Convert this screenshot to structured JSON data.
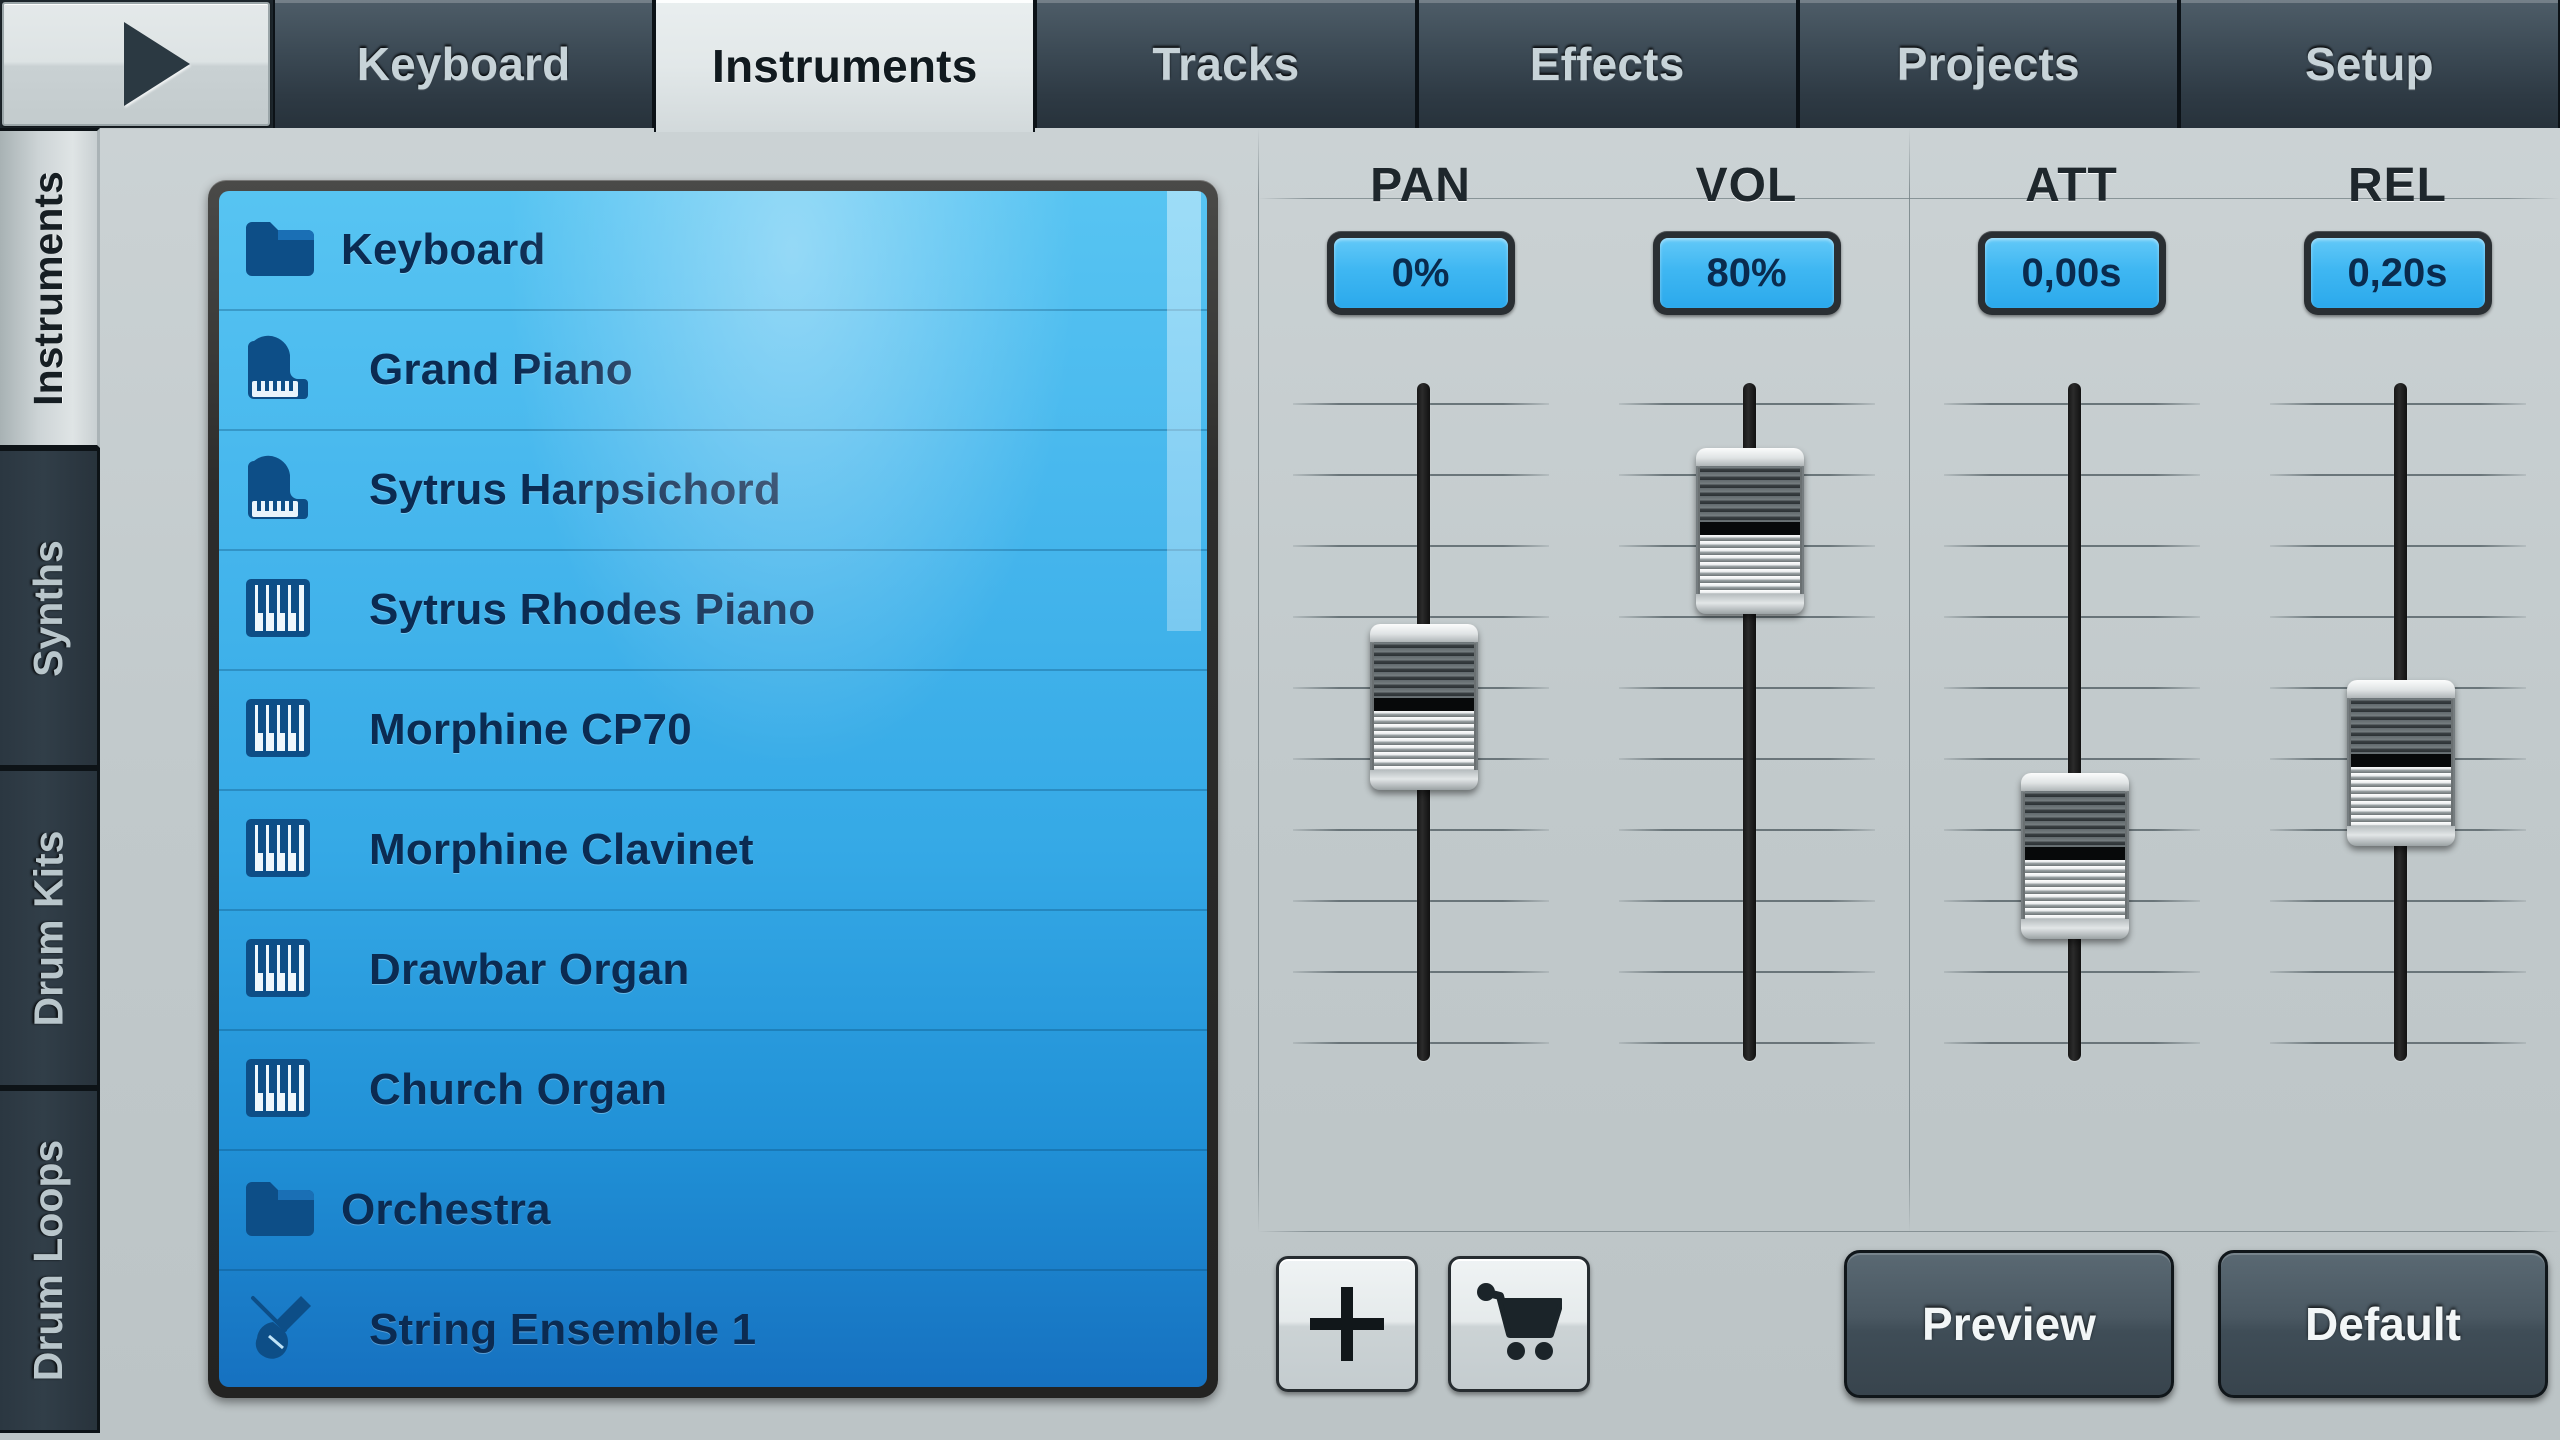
{
  "topbar": {
    "play_icon": "play-icon",
    "tabs": [
      {
        "label": "Keyboard",
        "active": false
      },
      {
        "label": "Instruments",
        "active": true
      },
      {
        "label": "Tracks",
        "active": false
      },
      {
        "label": "Effects",
        "active": false
      },
      {
        "label": "Projects",
        "active": false
      },
      {
        "label": "Setup",
        "active": false
      }
    ]
  },
  "sidebar": {
    "items": [
      {
        "label": "Instruments",
        "active": true
      },
      {
        "label": "Synths",
        "active": false
      },
      {
        "label": "Drum Kits",
        "active": false
      },
      {
        "label": "Drum Loops",
        "active": false
      }
    ]
  },
  "instrument_list": {
    "rows": [
      {
        "label": "Keyboard",
        "icon": "folder-icon",
        "type": "folder"
      },
      {
        "label": "Grand Piano",
        "icon": "grand-piano-icon",
        "type": "child"
      },
      {
        "label": "Sytrus Harpsichord",
        "icon": "grand-piano-icon",
        "type": "child"
      },
      {
        "label": "Sytrus Rhodes Piano",
        "icon": "keys-icon",
        "type": "child"
      },
      {
        "label": "Morphine CP70",
        "icon": "keys-icon",
        "type": "child"
      },
      {
        "label": "Morphine Clavinet",
        "icon": "keys-icon",
        "type": "child"
      },
      {
        "label": "Drawbar Organ",
        "icon": "keys-icon",
        "type": "child"
      },
      {
        "label": "Church Organ",
        "icon": "keys-icon",
        "type": "child"
      },
      {
        "label": "Orchestra",
        "icon": "folder-icon",
        "type": "folder"
      },
      {
        "label": "String Ensemble 1",
        "icon": "violin-icon",
        "type": "child"
      }
    ]
  },
  "controls": [
    {
      "label": "PAN",
      "value": "0%",
      "handle_pct": 47
    },
    {
      "label": "VOL",
      "value": "80%",
      "handle_pct": 13
    },
    {
      "label": "ATT",
      "value": "0,00s",
      "handle_pct": 76
    },
    {
      "label": "REL",
      "value": "0,20s",
      "handle_pct": 58
    }
  ],
  "actions": {
    "add_label": "+",
    "add_icon": "plus-icon",
    "store_icon": "shopping-cart-icon",
    "preview_label": "Preview",
    "default_label": "Default"
  },
  "colors": {
    "accent_blue": "#3fb7f2",
    "list_blue_top": "#57c4f2",
    "list_blue_bottom": "#1671c0",
    "tab_dark": "#2e3a44",
    "panel_bg": "#c5cdcf",
    "text_dark": "#0b2b52"
  }
}
